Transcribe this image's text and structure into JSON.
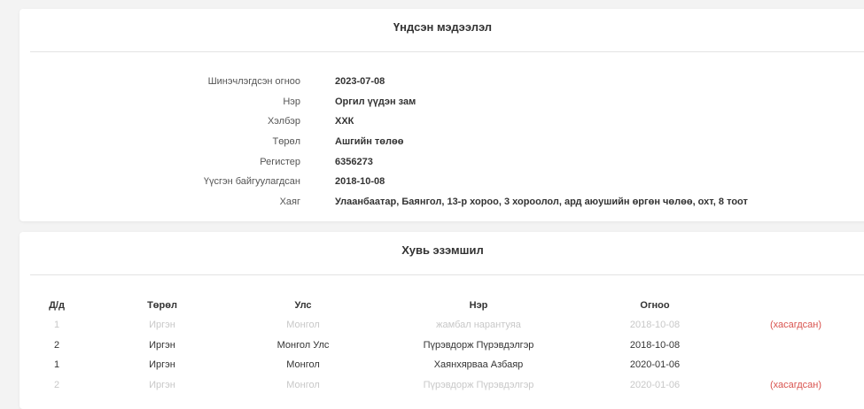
{
  "basic": {
    "title": "Үндсэн мэдээлэл",
    "fields": [
      {
        "label": "Шинэчлэгдсэн огноо",
        "value": "2023-07-08"
      },
      {
        "label": "Нэр",
        "value": "Оргил үүдэн зам"
      },
      {
        "label": "Хэлбэр",
        "value": "ХХК"
      },
      {
        "label": "Төрөл",
        "value": "Ашгийн төлөө"
      },
      {
        "label": "Регистер",
        "value": "6356273"
      },
      {
        "label": "Үүсгэн байгуулагдсан",
        "value": "2018-10-08"
      },
      {
        "label": "Хаяг",
        "value": "Улаанбаатар, Баянгол, 13-р хороо, 3 хороолол, ард аюушийн өргөн чөлөө, охт, 8 тоот"
      }
    ]
  },
  "ownership": {
    "title": "Хувь эзэмшил",
    "columns": [
      "Д/д",
      "Төрөл",
      "Улс",
      "Нэр",
      "Огноо",
      ""
    ],
    "rows": [
      {
        "no": "1",
        "type": "Иргэн",
        "country": "Монгол",
        "name": "жамбал нарантуяа",
        "date": "2018-10-08",
        "status": "(хасагдсан)",
        "deleted": true
      },
      {
        "no": "2",
        "type": "Иргэн",
        "country": "Монгол Улс",
        "name": "Пүрэвдорж Пүрэвдэлгэр",
        "date": "2018-10-08",
        "status": "",
        "deleted": false
      },
      {
        "no": "1",
        "type": "Иргэн",
        "country": "Монгол",
        "name": "Хаянхярваа Азбаяр",
        "date": "2020-01-06",
        "status": "",
        "deleted": false
      },
      {
        "no": "2",
        "type": "Иргэн",
        "country": "Монгол",
        "name": "Пүрэвдорж Пүрэвдэлгэр",
        "date": "2020-01-06",
        "status": "(хасагдсан)",
        "deleted": true
      }
    ]
  }
}
